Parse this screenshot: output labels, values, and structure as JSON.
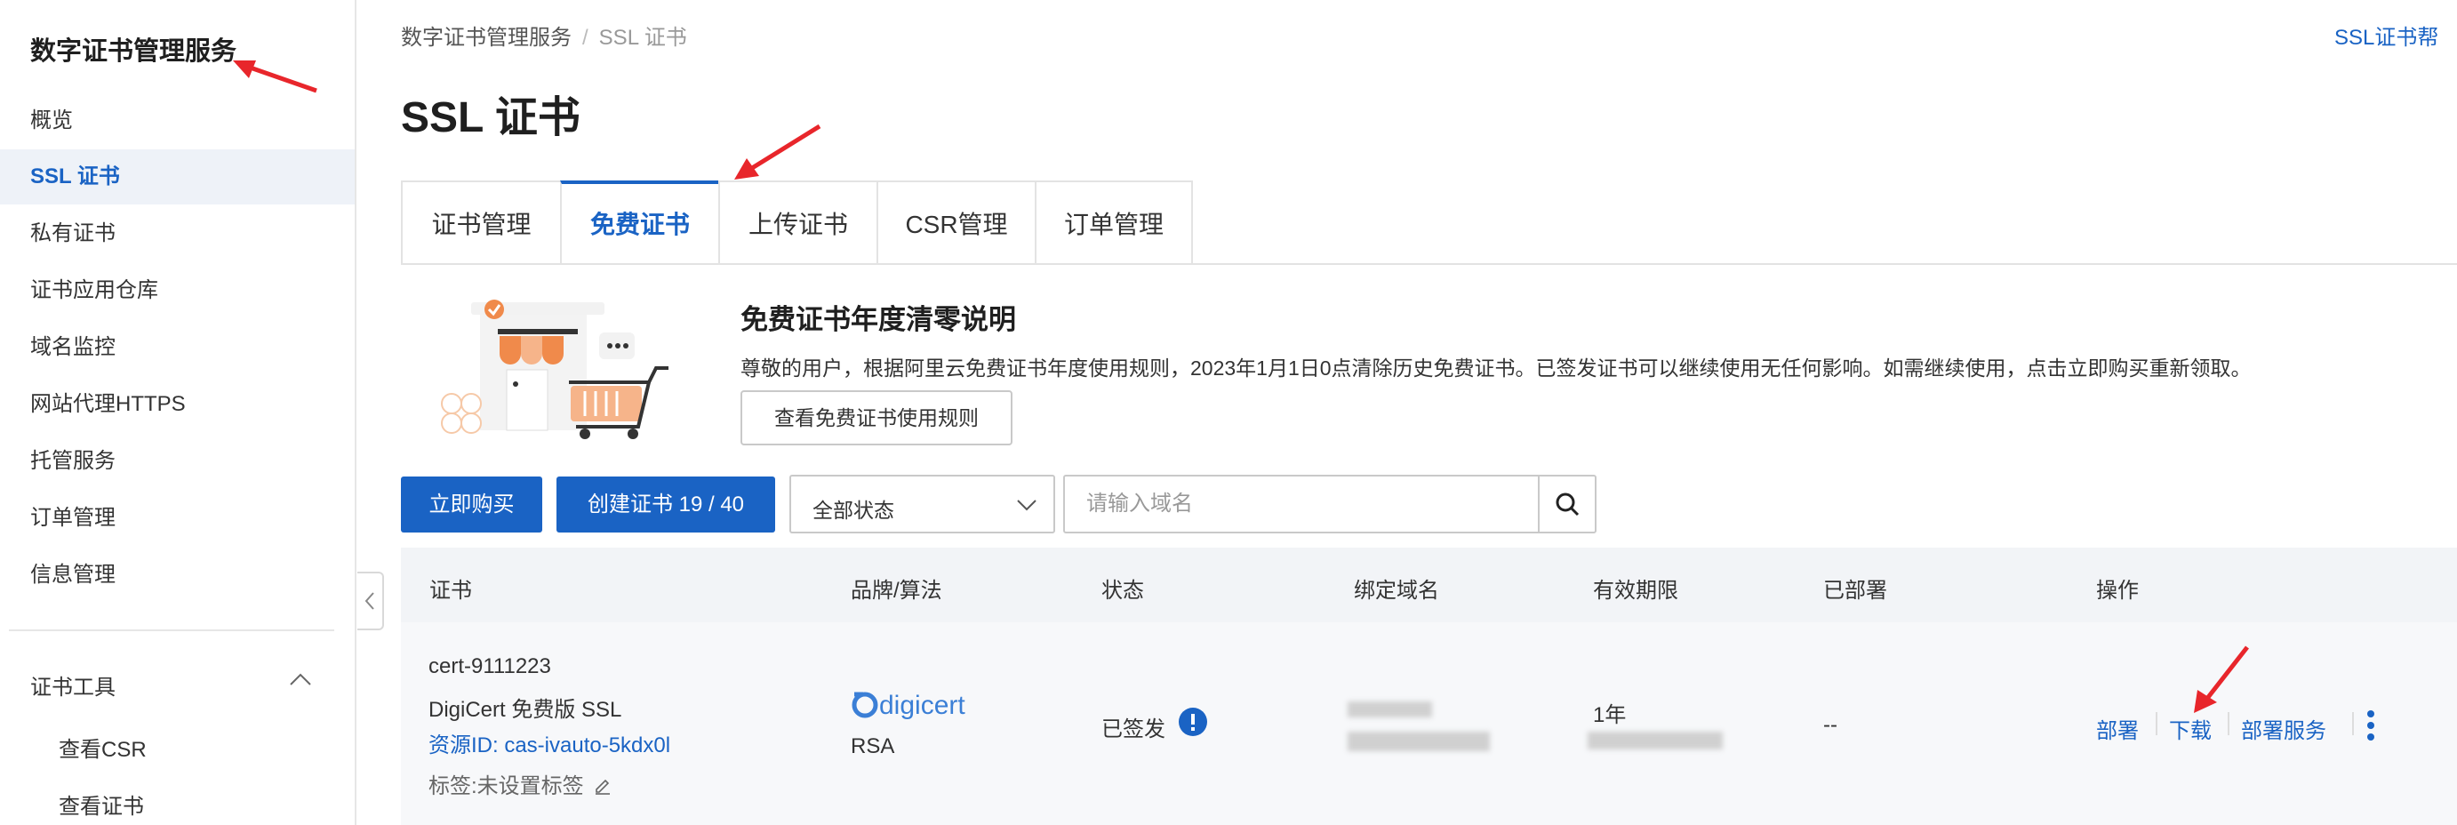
{
  "sidebar": {
    "title": "数字证书管理服务",
    "items": [
      {
        "label": "概览"
      },
      {
        "label": "SSL 证书",
        "active": true
      },
      {
        "label": "私有证书"
      },
      {
        "label": "证书应用仓库"
      },
      {
        "label": "域名监控"
      },
      {
        "label": "网站代理HTTPS"
      },
      {
        "label": "托管服务"
      },
      {
        "label": "订单管理"
      },
      {
        "label": "信息管理"
      }
    ],
    "group": {
      "label": "证书工具",
      "expanded": true,
      "items": [
        {
          "label": "查看CSR"
        },
        {
          "label": "查看证书"
        }
      ]
    }
  },
  "breadcrumb": {
    "root": "数字证书管理服务",
    "separator": "/",
    "current": "SSL 证书"
  },
  "top_link": "SSL证书帮",
  "page_title": "SSL 证书",
  "tabs": [
    {
      "label": "证书管理"
    },
    {
      "label": "免费证书",
      "active": true
    },
    {
      "label": "上传证书"
    },
    {
      "label": "CSR管理"
    },
    {
      "label": "订单管理"
    }
  ],
  "notice": {
    "title": "免费证书年度清零说明",
    "text": "尊敬的用户，根据阿里云免费证书年度使用规则，2023年1月1日0点清除历史免费证书。已签发证书可以继续使用无任何影响。如需继续使用，点击立即购买重新领取。",
    "button": "查看免费证书使用规则"
  },
  "toolbar": {
    "buy_button": "立即购买",
    "create_button": "创建证书 19 / 40",
    "status_select": "全部状态",
    "search_placeholder": "请输入域名"
  },
  "table": {
    "headers": [
      "证书",
      "品牌/算法",
      "状态",
      "绑定域名",
      "有效期限",
      "已部署",
      "操作"
    ],
    "rows": [
      {
        "cert_name": "cert-9111223",
        "cert_type": "DigiCert 免费版 SSL",
        "resource_id": "资源ID: cas-ivauto-5kdx0l",
        "tag": "标签:未设置标签",
        "brand": "digicert",
        "algorithm": "RSA",
        "status": "已签发",
        "validity": "1年",
        "deployed": "--",
        "actions": [
          "部署",
          "下载",
          "部署服务"
        ]
      }
    ]
  },
  "colors": {
    "accent": "#1a63c4",
    "annotation_arrow": "#e8262b"
  }
}
